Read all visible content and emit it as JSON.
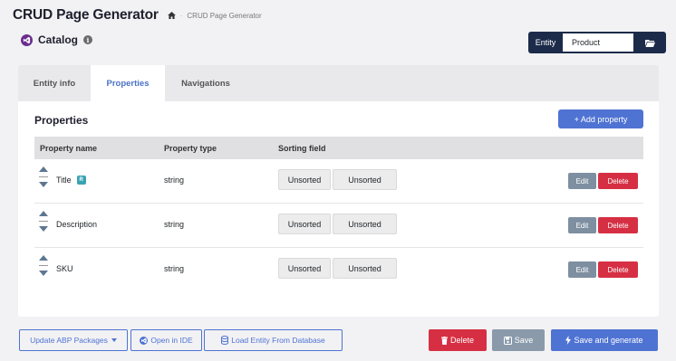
{
  "header": {
    "app_title": "CRUD Page Generator",
    "breadcrumb": "CRUD Page Generator",
    "catalog_title": "Catalog"
  },
  "entity": {
    "label": "Entity",
    "value": "Product"
  },
  "tabs": [
    {
      "label": "Entity info",
      "active": false
    },
    {
      "label": "Properties",
      "active": true
    },
    {
      "label": "Navigations",
      "active": false
    }
  ],
  "properties": {
    "title": "Properties",
    "add_label": "+ Add property",
    "columns": [
      "Property name",
      "Property type",
      "Sorting field"
    ],
    "rows": [
      {
        "name": "Title",
        "badge": "R",
        "type": "string",
        "sort1": "Unsorted",
        "sort2": "Unsorted",
        "edit": "Edit",
        "delete": "Delete"
      },
      {
        "name": "Description",
        "type": "string",
        "sort1": "Unsorted",
        "sort2": "Unsorted",
        "edit": "Edit",
        "delete": "Delete"
      },
      {
        "name": "SKU",
        "type": "string",
        "sort1": "Unsorted",
        "sort2": "Unsorted",
        "edit": "Edit",
        "delete": "Delete"
      }
    ]
  },
  "footer": {
    "update_abp": "Update ABP Packages",
    "open_ide": "Open in IDE",
    "load_entity": "Load Entity From Database",
    "delete": "Delete",
    "save": "Save",
    "save_generate": "Save and generate"
  },
  "colors": {
    "primary": "#4f73d3",
    "danger": "#d62f43",
    "secondary": "#7e8fa1",
    "dark": "#1c2b4a"
  }
}
